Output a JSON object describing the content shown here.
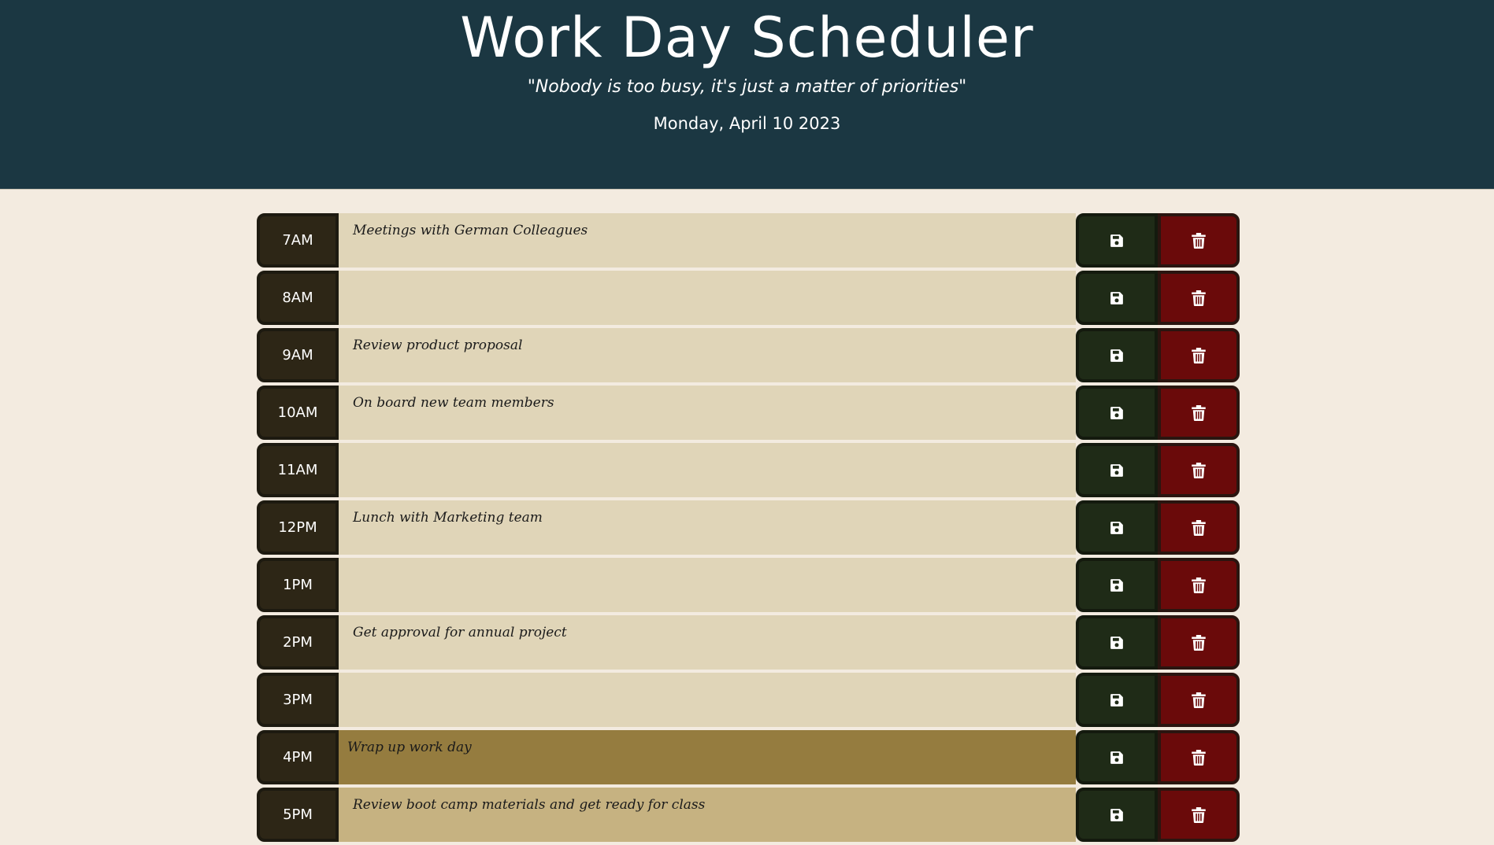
{
  "header": {
    "title": "Work Day Scheduler",
    "quote": "\"Nobody is too busy, it's just a matter of priorities\"",
    "date": "Monday, April 10 2023"
  },
  "colors": {
    "header_bg": "#1b3742",
    "past": "#e0d5b8",
    "present": "#957c3f",
    "future": "#c6b281",
    "save": "#1f2b17",
    "delete": "#6a0a0a"
  },
  "rows": [
    {
      "hour": "7AM",
      "text": "Meetings with German Colleagues",
      "state": "past"
    },
    {
      "hour": "8AM",
      "text": "",
      "state": "past"
    },
    {
      "hour": "9AM",
      "text": "Review product proposal",
      "state": "past"
    },
    {
      "hour": "10AM",
      "text": "On board new team members",
      "state": "past"
    },
    {
      "hour": "11AM",
      "text": "",
      "state": "past"
    },
    {
      "hour": "12PM",
      "text": "Lunch with Marketing team",
      "state": "past"
    },
    {
      "hour": "1PM",
      "text": "",
      "state": "past"
    },
    {
      "hour": "2PM",
      "text": "Get approval for annual project",
      "state": "past"
    },
    {
      "hour": "3PM",
      "text": "",
      "state": "past"
    },
    {
      "hour": "4PM",
      "text": "Wrap up work day",
      "state": "present"
    },
    {
      "hour": "5PM",
      "text": "Review boot camp materials and get ready for class",
      "state": "future"
    }
  ],
  "icons": {
    "save": "floppy-disk-icon",
    "delete": "trash-icon"
  }
}
